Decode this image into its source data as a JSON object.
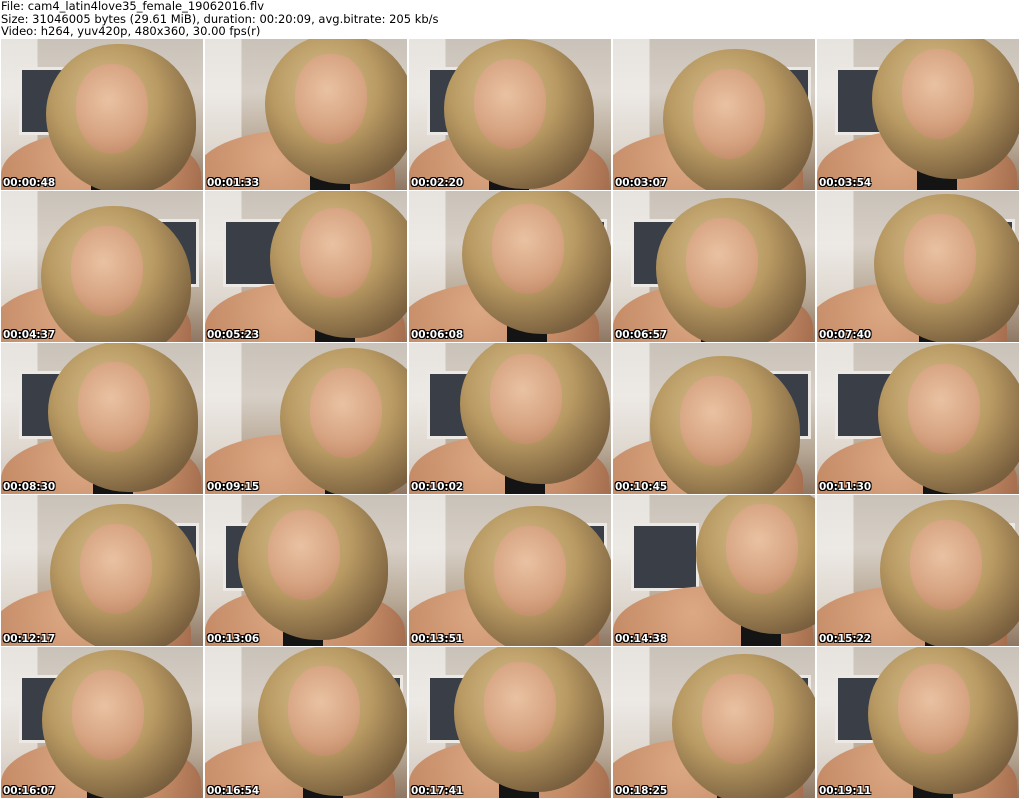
{
  "header": {
    "file_line": "File: cam4_latin4love35_female_19062016.flv",
    "size_line": "Size: 31046005 bytes (29.61 MiB), duration: 00:20:09, avg.bitrate: 205 kb/s",
    "video_line": "Video: h264, yuv420p, 480x360, 30.00 fps(r)"
  },
  "thumbnails": [
    {
      "timestamp": "00:00:48"
    },
    {
      "timestamp": "00:01:33"
    },
    {
      "timestamp": "00:02:20"
    },
    {
      "timestamp": "00:03:07"
    },
    {
      "timestamp": "00:03:54"
    },
    {
      "timestamp": "00:04:37"
    },
    {
      "timestamp": "00:05:23"
    },
    {
      "timestamp": "00:06:08"
    },
    {
      "timestamp": "00:06:57"
    },
    {
      "timestamp": "00:07:40"
    },
    {
      "timestamp": "00:08:30"
    },
    {
      "timestamp": "00:09:15"
    },
    {
      "timestamp": "00:10:02"
    },
    {
      "timestamp": "00:10:45"
    },
    {
      "timestamp": "00:11:30"
    },
    {
      "timestamp": "00:12:17"
    },
    {
      "timestamp": "00:13:06"
    },
    {
      "timestamp": "00:13:51"
    },
    {
      "timestamp": "00:14:38"
    },
    {
      "timestamp": "00:15:22"
    },
    {
      "timestamp": "00:16:07"
    },
    {
      "timestamp": "00:16:54"
    },
    {
      "timestamp": "00:17:41"
    },
    {
      "timestamp": "00:18:25"
    },
    {
      "timestamp": "00:19:11"
    }
  ]
}
